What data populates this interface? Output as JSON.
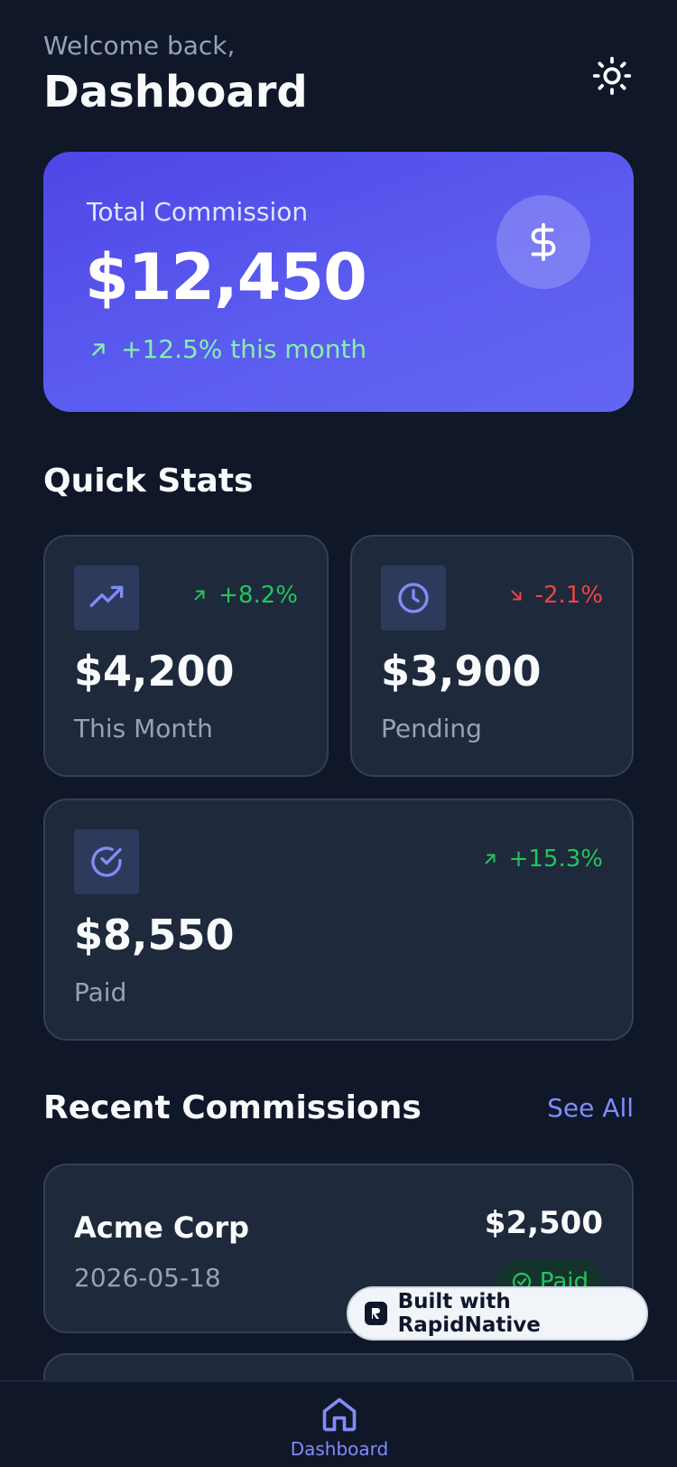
{
  "header": {
    "welcome": "Welcome back,",
    "title": "Dashboard"
  },
  "hero": {
    "label": "Total Commission",
    "amount": "$12,450",
    "trend": "+12.5% this month"
  },
  "quick_stats": {
    "title": "Quick Stats",
    "cards": [
      {
        "icon": "trending-up-icon",
        "trend": "+8.2%",
        "direction": "up",
        "value": "$4,200",
        "label": "This Month"
      },
      {
        "icon": "clock-icon",
        "trend": "-2.1%",
        "direction": "down",
        "value": "$3,900",
        "label": "Pending"
      },
      {
        "icon": "check-circle-icon",
        "trend": "+15.3%",
        "direction": "up",
        "value": "$8,550",
        "label": "Paid"
      }
    ]
  },
  "recent": {
    "title": "Recent Commissions",
    "see_all": "See All",
    "items": [
      {
        "company": "Acme Corp",
        "date": "2026-05-18",
        "amount": "$2,500",
        "status": "Paid"
      }
    ]
  },
  "built_with": "Built with RapidNative",
  "nav": {
    "items": [
      {
        "label": "Dashboard",
        "icon": "home-icon",
        "active": true
      }
    ]
  },
  "colors": {
    "background": "#0f1729",
    "card": "#1e293b",
    "accent": "#6366f1",
    "positive": "#22c55e",
    "negative": "#ef4444"
  }
}
